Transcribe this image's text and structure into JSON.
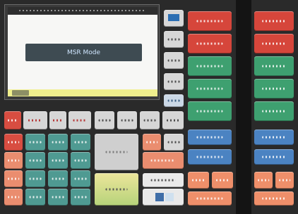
{
  "screen": {
    "mode_label": "MSR Mode"
  }
}
